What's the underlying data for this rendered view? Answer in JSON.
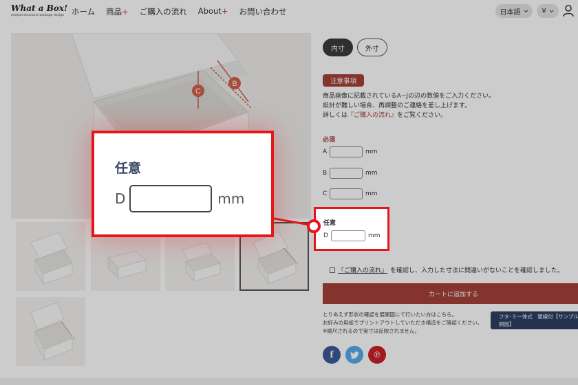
{
  "header": {
    "logo_main": "What a Box!",
    "logo_sub": "original structural package design",
    "nav": [
      {
        "label": "ホーム",
        "plus": ""
      },
      {
        "label": "商品",
        "plus": "+"
      },
      {
        "label": "ご購入の流れ",
        "plus": ""
      },
      {
        "label": "About",
        "plus": "+"
      },
      {
        "label": "お問い合わせ",
        "plus": ""
      }
    ],
    "language": "日本語",
    "currency": "¥"
  },
  "product": {
    "tab_inner": "内寸",
    "tab_outer": "外寸",
    "notice_badge": "注意事項",
    "notice_line1": "商品画像に記載されているA~Jの辺の数値をご入力ください。",
    "notice_line2": "設計が難しい場合、再調整のご連絡を差し上げます。",
    "notice_line3_pre": "詳しくは",
    "notice_line3_link": "『ご購入の流れ』",
    "notice_line3_post": "をご覧ください。",
    "required_label": "必須",
    "fields": [
      {
        "letter": "A",
        "unit": "mm"
      },
      {
        "letter": "B",
        "unit": "mm"
      },
      {
        "letter": "C",
        "unit": "mm"
      }
    ],
    "optional_label": "任意",
    "optional_field": {
      "letter": "D",
      "unit": "mm"
    },
    "confirm_link": "『ご購入の流れ』",
    "confirm_text": "を確認し、入力した寸法に間違いがないことを確認しました。",
    "cart_button": "カートに追加する",
    "note_line1": "とりあえず形状の確認を展開図にて行いたい方はこちら。",
    "note_line2": "お好みの用紙でプリントアウトしていただき構造をご確認ください。",
    "note_line3": "※縮尺されるので実寸は反映されません。",
    "sample_button": "フタ･ミー体式　鎖線付【サンプル展開図】"
  },
  "image_labels": {
    "b": "B",
    "c": "C"
  },
  "zoom": {
    "title": "任意",
    "letter": "D",
    "unit": "mm"
  },
  "colors": {
    "accent": "#a54237",
    "highlight": "#e8141b",
    "navy": "#2f3f63"
  }
}
